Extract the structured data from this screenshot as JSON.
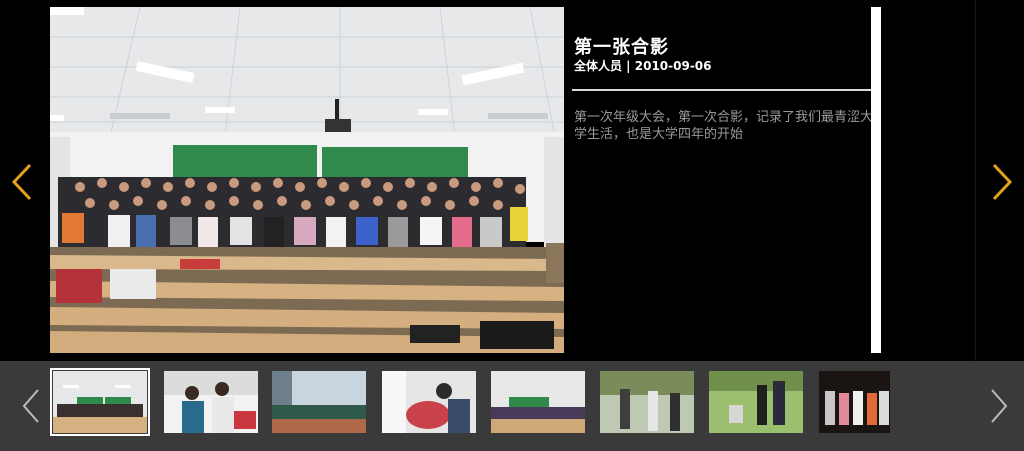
{
  "photo": {
    "title": "第一张合影",
    "meta": "全体人员 | 2010-09-06",
    "description": "第一次年级大会，第一次合影，记录了我们最青涩大学生活，也是大学四年的开始"
  },
  "colors": {
    "nav_arrow_main": "#e2a31a",
    "nav_arrow_strip": "#bdbdbd",
    "strip_background": "#3a3a3a",
    "caption_description": "#9a9a9a"
  },
  "thumbnails": {
    "count_visible": 8,
    "selected_index": 0
  }
}
